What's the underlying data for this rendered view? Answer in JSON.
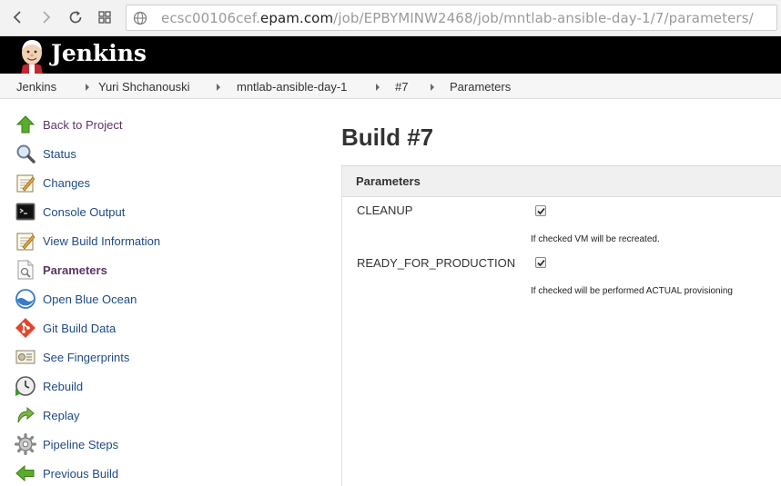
{
  "browser": {
    "url_prefix": "ecsc00106cef.",
    "url_domain": "epam.com",
    "url_path": "/job/EPBYMINW2468/job/mntlab-ansible-day-1/7/parameters/"
  },
  "header": {
    "title": "Jenkins"
  },
  "breadcrumb": {
    "items": [
      "Jenkins",
      "Yuri Shchanouski",
      "mntlab-ansible-day-1",
      "#7",
      "Parameters"
    ]
  },
  "sidebar": {
    "items": [
      {
        "label": "Back to Project",
        "icon": "up-arrow-icon"
      },
      {
        "label": "Status",
        "icon": "magnifier-icon"
      },
      {
        "label": "Changes",
        "icon": "notepad-icon"
      },
      {
        "label": "Console Output",
        "icon": "terminal-icon"
      },
      {
        "label": "View Build Information",
        "icon": "notepad-icon"
      },
      {
        "label": "Parameters",
        "icon": "document-search-icon"
      },
      {
        "label": "Open Blue Ocean",
        "icon": "blue-ocean-icon"
      },
      {
        "label": "Git Build Data",
        "icon": "git-icon"
      },
      {
        "label": "See Fingerprints",
        "icon": "fingerprint-icon"
      },
      {
        "label": "Rebuild",
        "icon": "clock-icon"
      },
      {
        "label": "Replay",
        "icon": "replay-arrow-icon"
      },
      {
        "label": "Pipeline Steps",
        "icon": "gear-icon"
      },
      {
        "label": "Previous Build",
        "icon": "left-arrow-icon"
      }
    ]
  },
  "main": {
    "title": "Build #7",
    "section_title": "Parameters",
    "parameters": [
      {
        "name": "CLEANUP",
        "checked": true,
        "description": "If checked VM will be recreated."
      },
      {
        "name": "READY_FOR_PRODUCTION",
        "checked": true,
        "description": "If checked will be performed ACTUAL provisioning"
      }
    ]
  },
  "colors": {
    "link": "#204a87",
    "visited": "#5c3566",
    "header_bg": "#000000"
  }
}
